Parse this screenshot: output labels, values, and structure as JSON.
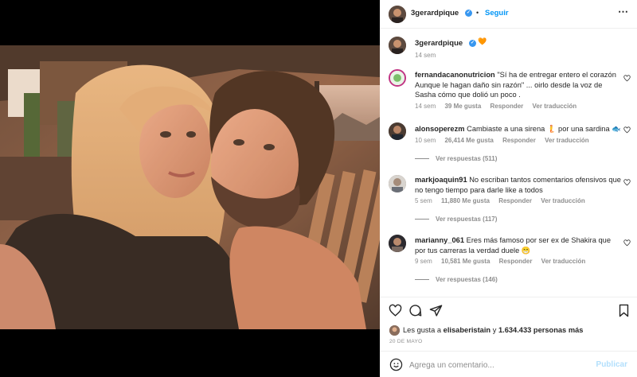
{
  "post": {
    "author": "3gerardpique",
    "follow_label": "Seguir",
    "separator": "•",
    "caption_author": "3gerardpique",
    "caption_emoji": "🧡",
    "caption_time": "14 sem"
  },
  "comments": [
    {
      "user": "fernandacanonutricion",
      "text": "\"Sí ha de entregar entero el corazón Aunque le hagan daño sin razón\" ... oirlo desde la voz de Sasha cómo que dolió un poco .",
      "time": "14 sem",
      "likes": "39 Me gusta",
      "reply": "Responder",
      "translate": "Ver traducción"
    },
    {
      "user": "alonsoperezm",
      "text": "Cambiaste a una sirena 🧜 por una sardina 🐟",
      "time": "10 sem",
      "likes": "26,414 Me gusta",
      "reply": "Responder",
      "translate": "Ver traducción",
      "replies": "Ver respuestas (511)"
    },
    {
      "user": "markjoaquin91",
      "text": "No escriban tantos comentarios ofensivos que no tengo tiempo para darle like a todos",
      "time": "5 sem",
      "likes": "11,880 Me gusta",
      "reply": "Responder",
      "translate": "Ver traducción",
      "replies": "Ver respuestas (117)"
    },
    {
      "user": "marianny_061",
      "text": "Eres más famoso por ser ex de Shakira que por tus carreras la verdad duele 😁",
      "time": "9 sem",
      "likes": "10,581 Me gusta",
      "reply": "Responder",
      "translate": "Ver traducción",
      "replies": "Ver respuestas (146)"
    }
  ],
  "likes": {
    "prefix": "Les gusta a",
    "user": "elisaberistain",
    "connector": "y",
    "count": "1.634.433 personas más"
  },
  "date": "20 DE MAYO",
  "composer": {
    "placeholder": "Agrega un comentario...",
    "publish_label": "Publicar"
  },
  "colors": {
    "accent": "#0095f6",
    "verified": "#3897f0",
    "muted": "#8e8e8e"
  },
  "icons": [
    "more-icon",
    "heart-icon",
    "comment-icon",
    "share-icon",
    "bookmark-icon",
    "emoji-icon",
    "verified-icon"
  ]
}
